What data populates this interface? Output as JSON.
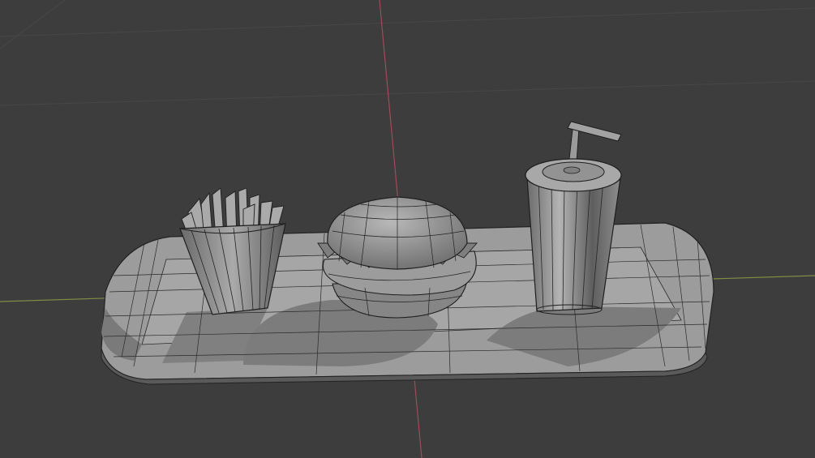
{
  "viewport": {
    "mode": "3d-viewport",
    "shading": "solid-wireframe-overlay",
    "background_color": "#3d3d3d",
    "grid_line_color": "#4a4a4a",
    "x_axis_color": "#8b9a4a",
    "y_axis_color": "#a04a5a"
  },
  "scene": {
    "objects": [
      {
        "name": "tray-mesh",
        "icon": "mesh-tray"
      },
      {
        "name": "fries-mesh",
        "icon": "mesh-fries"
      },
      {
        "name": "burger-mesh",
        "icon": "mesh-burger"
      },
      {
        "name": "cup-mesh",
        "icon": "mesh-cup-with-straw"
      }
    ],
    "mesh_fill_color": "#9a9a9a",
    "mesh_shadow_color": "#7a7a7a",
    "wire_color": "#1f1f1f"
  }
}
